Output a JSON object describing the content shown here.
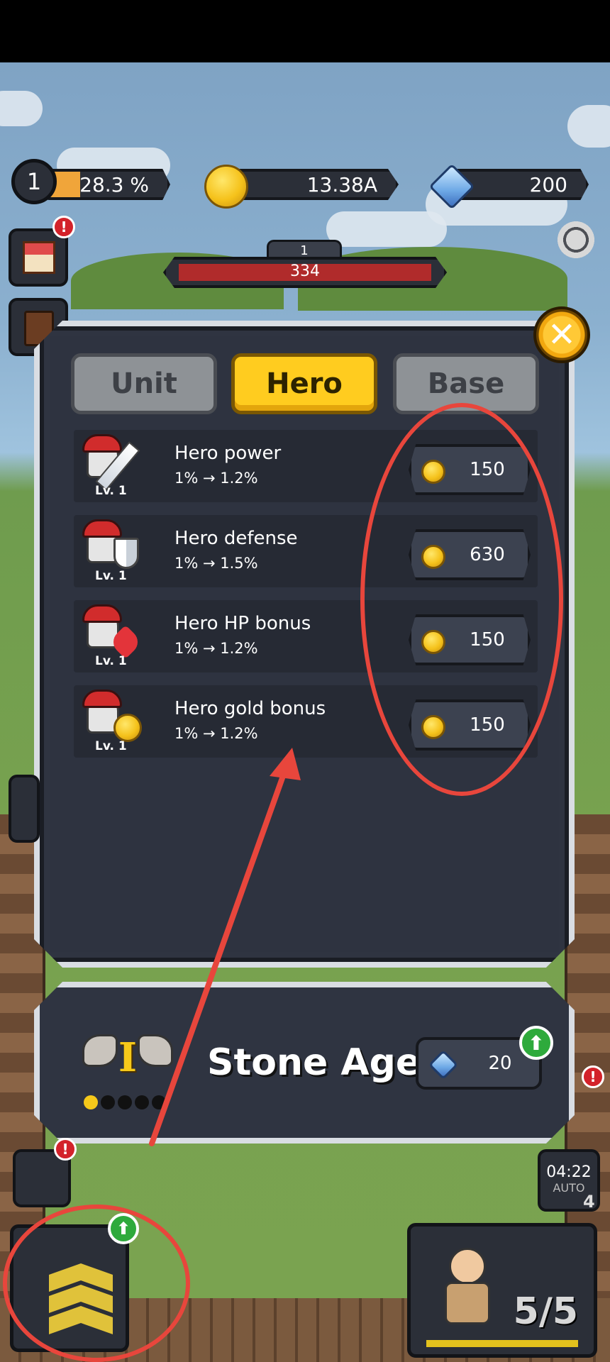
{
  "hud": {
    "level": "1",
    "xp_percent_label": "28.3 %",
    "xp_progress": 0.283,
    "gold": "13.38A",
    "gems": "200"
  },
  "boss": {
    "stage": "1",
    "hp": "334"
  },
  "tabs": [
    {
      "label": "Unit",
      "active": false
    },
    {
      "label": "Hero",
      "active": true
    },
    {
      "label": "Base",
      "active": false
    }
  ],
  "upgrades": [
    {
      "name": "Hero power",
      "change": "1% → 1.2%",
      "level": "Lv. 1",
      "cost": "150",
      "icon": "sword-icon"
    },
    {
      "name": "Hero defense",
      "change": "1% → 1.5%",
      "level": "Lv. 1",
      "cost": "630",
      "icon": "shield-icon"
    },
    {
      "name": "Hero HP bonus",
      "change": "1% → 1.2%",
      "level": "Lv. 1",
      "cost": "150",
      "icon": "heart-icon"
    },
    {
      "name": "Hero gold bonus",
      "change": "1% → 1.2%",
      "level": "Lv. 1",
      "cost": "150",
      "icon": "gold-coin-icon"
    }
  ],
  "era": {
    "title": "Stone Age",
    "roman": "I",
    "cost": "20",
    "progress_filled": 1,
    "progress_total": 5
  },
  "bottom": {
    "hero_count": "5/5",
    "timer": "04:22",
    "auto_label": "AUTO",
    "auto_count": "4"
  },
  "colors": {
    "accent_tab": "#ffcc1f",
    "panel_bg": "#2f3441",
    "annotation": "#e8463c"
  }
}
